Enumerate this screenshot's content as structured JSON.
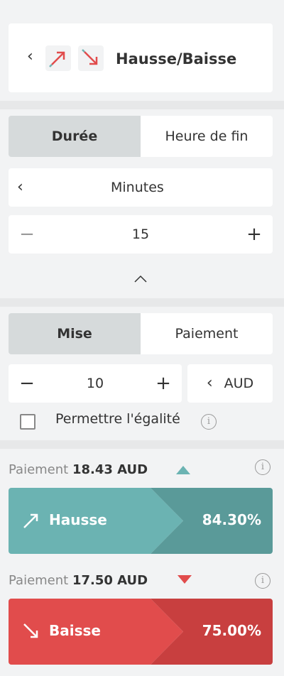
{
  "header": {
    "title": "Hausse/Baisse",
    "up_icon": "arrow-up-right-icon",
    "down_icon": "arrow-down-right-icon"
  },
  "duration": {
    "tabs": [
      "Durée",
      "Heure de fin"
    ],
    "active_tab": "Durée",
    "unit": "Minutes",
    "value": "15"
  },
  "stake": {
    "tabs": [
      "Mise",
      "Paiement"
    ],
    "active_tab": "Mise",
    "amount": "10",
    "currency": "AUD",
    "allow_equals_label": "Permettre l'égalité",
    "allow_equals_checked": false
  },
  "rise": {
    "payout_prefix": "Paiement",
    "payout_amount": "18.43 AUD",
    "label": "Hausse",
    "percent": "84.30%",
    "color": "#6bb3b2",
    "color_dark": "#5a9a99"
  },
  "fall": {
    "payout_prefix": "Paiement",
    "payout_amount": "17.50 AUD",
    "label": "Baisse",
    "percent": "75.00%",
    "color": "#e14c4c",
    "color_dark": "#c83f3f"
  }
}
